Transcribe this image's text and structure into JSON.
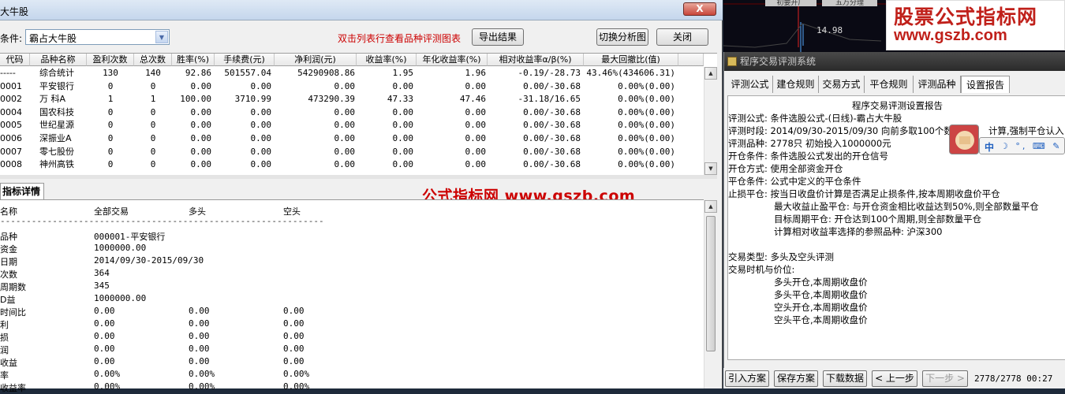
{
  "left_window": {
    "title": "大牛股",
    "close_label": "X",
    "condition_label": "条件:",
    "condition_value": "霸占大牛股",
    "hint": "双击列表行查看品种评测图表",
    "export_label": "导出结果",
    "switch_chart_label": "切换分析图",
    "close_button_label": "关闭"
  },
  "table": {
    "headers": [
      "代码",
      "品种名称",
      "盈利次数",
      "总次数",
      "胜率(%)",
      "手续费(元)",
      "净利润(元)",
      "收益率(%)",
      "年化收益率(%)",
      "相对收益率α/β(%)",
      "最大回撤比(值)"
    ],
    "rows": [
      [
        "-----",
        "综合统计",
        "130",
        "140",
        "92.86",
        "501557.04",
        "54290908.86",
        "1.95",
        "1.96",
        "-0.19/-28.73",
        "43.46%(434606.31)"
      ],
      [
        "0001",
        "平安银行",
        "0",
        "0",
        "0.00",
        "0.00",
        "0.00",
        "0.00",
        "0.00",
        "0.00/-30.68",
        "0.00%(0.00)"
      ],
      [
        "0002",
        "万 科A",
        "1",
        "1",
        "100.00",
        "3710.99",
        "473290.39",
        "47.33",
        "47.46",
        "-31.18/16.65",
        "0.00%(0.00)"
      ],
      [
        "0004",
        "国农科技",
        "0",
        "0",
        "0.00",
        "0.00",
        "0.00",
        "0.00",
        "0.00",
        "0.00/-30.68",
        "0.00%(0.00)"
      ],
      [
        "0005",
        "世纪星源",
        "0",
        "0",
        "0.00",
        "0.00",
        "0.00",
        "0.00",
        "0.00",
        "0.00/-30.68",
        "0.00%(0.00)"
      ],
      [
        "0006",
        "深振业A",
        "0",
        "0",
        "0.00",
        "0.00",
        "0.00",
        "0.00",
        "0.00",
        "0.00/-30.68",
        "0.00%(0.00)"
      ],
      [
        "0007",
        "零七股份",
        "0",
        "0",
        "0.00",
        "0.00",
        "0.00",
        "0.00",
        "0.00",
        "0.00/-30.68",
        "0.00%(0.00)"
      ],
      [
        "0008",
        "神州高铁",
        "0",
        "0",
        "0.00",
        "0.00",
        "0.00",
        "0.00",
        "0.00",
        "0.00/-30.68",
        "0.00%(0.00)"
      ]
    ]
  },
  "detail": {
    "tab_label": "指标详情",
    "watermark": "公式指标网 www.gszb.com",
    "col_headers": [
      "名称",
      "全部交易",
      "多头",
      "空头"
    ],
    "separator": "------------------------------------------------------------------------------------------",
    "rows": [
      [
        "品种",
        "000001-平安银行",
        "",
        ""
      ],
      [
        "资金",
        "1000000.00",
        "",
        ""
      ],
      [
        "日期",
        "2014/09/30-2015/09/30",
        "",
        ""
      ],
      [
        "次数",
        "364",
        "",
        ""
      ],
      [
        "周期数",
        "345",
        "",
        ""
      ],
      [
        "D益",
        "1000000.00",
        "",
        ""
      ],
      [
        "时间比",
        "0.00",
        "0.00",
        "0.00"
      ],
      [
        "利",
        "0.00",
        "0.00",
        "0.00"
      ],
      [
        "损",
        "0.00",
        "0.00",
        "0.00"
      ],
      [
        "润",
        "0.00",
        "0.00",
        "0.00"
      ],
      [
        "收益",
        "0.00",
        "0.00",
        "0.00"
      ],
      [
        "率",
        "0.00%",
        "0.00%",
        "0.00%"
      ],
      [
        "收益率",
        "0.00%",
        "0.00%",
        "0.00%"
      ]
    ]
  },
  "top_right": {
    "tab1": "初要开厂",
    "tab2": "五万分理",
    "price": "14.98",
    "logo_title": "股票公式指标网",
    "logo_url": "www.gszb.com"
  },
  "right_window": {
    "title": "程序交易评测系统",
    "tabs": [
      "评测公式",
      "建仓规则",
      "交易方式",
      "平仓规则",
      "评测品种",
      "设置报告"
    ],
    "report_title": "程序交易评测设置报告",
    "report_lines": [
      "评测公式: 条件选股公式-(日线)-霸占大牛股",
      "评测时段: 2014/09/30-2015/09/30 向前多取100个数",
      "评测品种: 2778只  初始投入1000000元",
      "开仓条件: 条件选股公式发出的开仓信号",
      "开仓方式: 使用全部资金开仓",
      "平仓条件: 公式中定义的平仓条件",
      "止损平仓: 按当日收盘价计算是否满足止损条件,按本周期收盘价平仓",
      "最大收益止盈平仓: 与开仓资金相比收益达到50%,则全部数量平仓",
      "目标周期平仓: 开仓达到100个周期,则全部数量平仓",
      "计算相对收益率选择的参照品种: 沪深300",
      "交易类型: 多头及空头评测",
      "交易时机与价位:",
      "多头开仓,本周期收盘价",
      "多头平仓,本周期收盘价",
      "空头开仓,本周期收盘价",
      "空头平仓,本周期收盘价"
    ],
    "report_fragment": "计算,强制平仓认入"
  },
  "ime": {
    "zh": "中",
    "icons": "☽ °, ⌨ ✎"
  },
  "bottom": {
    "import": "引入方案",
    "save": "保存方案",
    "download": "下载数据",
    "prev": "< 上一步",
    "next": "下一步 >",
    "status": "2778/2778 00:27"
  }
}
